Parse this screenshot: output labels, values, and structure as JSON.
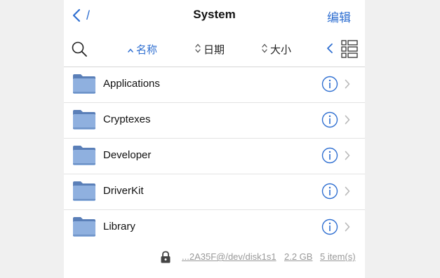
{
  "nav": {
    "back_label": "/",
    "title": "System",
    "edit_label": "编辑"
  },
  "toolbar": {
    "sort_options": [
      {
        "label": "名称",
        "active": true
      },
      {
        "label": "日期",
        "active": false
      },
      {
        "label": "大小",
        "active": false
      }
    ]
  },
  "files": [
    {
      "name": "Applications"
    },
    {
      "name": "Cryptexes"
    },
    {
      "name": "Developer"
    },
    {
      "name": "DriverKit"
    },
    {
      "name": "Library"
    }
  ],
  "footer": {
    "path": "...2A35F@/dev/disk1s1",
    "size": "2.2 GB",
    "count": "5 item(s)"
  },
  "colors": {
    "accent": "#2f6fd1",
    "folder": "#8fb0df"
  }
}
